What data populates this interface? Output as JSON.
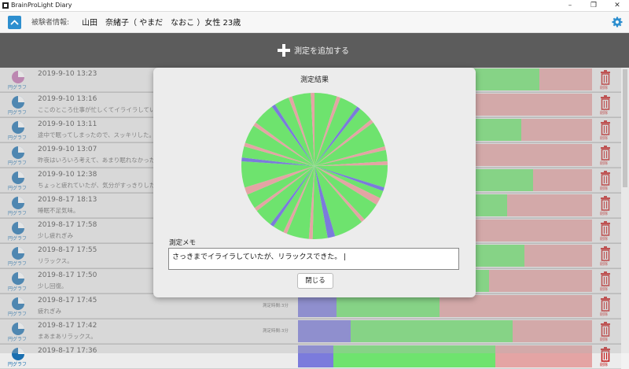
{
  "window": {
    "title": "BrainProLight Diary",
    "minimize": "–",
    "maximize": "❐",
    "close": "✕"
  },
  "subject": {
    "label": "被験者情報:",
    "value": "山田　奈緒子（ やまだ　なおこ ）女性 23歳"
  },
  "add_label": "測定を追加する",
  "colors": {
    "accent": "#2e8fcf",
    "purple": "#7b7bdc",
    "green": "#6ee36e",
    "pink": "#e4a4a4",
    "trash": "#c42020"
  },
  "row_icon_label": "円グラフ",
  "trash_label": "削除",
  "rows": [
    {
      "date": "2019-9-10 13:23",
      "memo": "",
      "duration": "",
      "bar": [
        0,
        0.82,
        0.18
      ],
      "active": true
    },
    {
      "date": "2019-9-10 13:16",
      "memo": "ここのところ仕事が忙しくてイライラしていた。",
      "duration": "",
      "bar": [
        0,
        0.3,
        0.7
      ]
    },
    {
      "date": "2019-9-10 13:11",
      "memo": "途中で眠ってしまったので、スッキリした。",
      "duration": "",
      "bar": [
        0,
        0.76,
        0.24
      ]
    },
    {
      "date": "2019-9-10 13:07",
      "memo": "昨夜はいろいろ考えて、あまり眠れなかった。",
      "duration": "",
      "bar": [
        0,
        0.25,
        0.75
      ]
    },
    {
      "date": "2019-9-10 12:38",
      "memo": "ちょっと疲れていたが、気分がすっきりした。",
      "duration": "",
      "bar": [
        0,
        0.8,
        0.2
      ]
    },
    {
      "date": "2019-8-17 18:13",
      "memo": "睡眠不足気味。",
      "duration": "",
      "bar": [
        0,
        0.71,
        0.29
      ]
    },
    {
      "date": "2019-8-17 17:58",
      "memo": "少し疲れぎみ",
      "duration": "",
      "bar": [
        0,
        0.55,
        0.45
      ]
    },
    {
      "date": "2019-8-17 17:55",
      "memo": "リラックス。",
      "duration": "",
      "bar": [
        0,
        0.77,
        0.23
      ]
    },
    {
      "date": "2019-8-17 17:50",
      "memo": "少し回復。",
      "duration": "",
      "bar": [
        0,
        0.65,
        0.35
      ]
    },
    {
      "date": "2019-8-17 17:45",
      "memo": "疲れぎみ",
      "duration": "測定時間:3分",
      "bar": [
        0.13,
        0.35,
        0.52
      ]
    },
    {
      "date": "2019-8-17 17:42",
      "memo": "まあまあリラックス。",
      "duration": "測定時間:3分",
      "bar": [
        0.18,
        0.55,
        0.27
      ]
    },
    {
      "date": "2019-8-17 17:36",
      "memo": "",
      "duration": "",
      "bar": [
        0.12,
        0.55,
        0.33
      ]
    }
  ],
  "dialog": {
    "title": "測定結果",
    "memo_label": "測定メモ",
    "memo_value": "さっきまでイライラしていたが、リラックスできた。",
    "close_label": "閉じる",
    "pie": {
      "slices": [
        {
          "c": "green",
          "w": 6
        },
        {
          "c": "pink",
          "w": 1
        },
        {
          "c": "green",
          "w": 5
        },
        {
          "c": "purple",
          "w": 1
        },
        {
          "c": "green",
          "w": 4
        },
        {
          "c": "pink",
          "w": 1
        },
        {
          "c": "green",
          "w": 7
        },
        {
          "c": "pink",
          "w": 1
        },
        {
          "c": "green",
          "w": 3
        },
        {
          "c": "pink",
          "w": 1
        },
        {
          "c": "green",
          "w": 6
        },
        {
          "c": "purple",
          "w": 1
        },
        {
          "c": "green",
          "w": 2
        },
        {
          "c": "pink",
          "w": 2
        },
        {
          "c": "green",
          "w": 5
        },
        {
          "c": "pink",
          "w": 1
        },
        {
          "c": "green",
          "w": 8
        },
        {
          "c": "purple",
          "w": 2
        },
        {
          "c": "green",
          "w": 4
        },
        {
          "c": "pink",
          "w": 1
        },
        {
          "c": "green",
          "w": 6
        },
        {
          "c": "pink",
          "w": 1
        },
        {
          "c": "green",
          "w": 3
        },
        {
          "c": "purple",
          "w": 1
        },
        {
          "c": "green",
          "w": 5
        },
        {
          "c": "pink",
          "w": 1
        },
        {
          "c": "green",
          "w": 4
        },
        {
          "c": "pink",
          "w": 2
        },
        {
          "c": "green",
          "w": 7
        },
        {
          "c": "purple",
          "w": 1
        },
        {
          "c": "green",
          "w": 3
        },
        {
          "c": "pink",
          "w": 1
        },
        {
          "c": "green",
          "w": 5
        },
        {
          "c": "pink",
          "w": 1
        },
        {
          "c": "green",
          "w": 6
        },
        {
          "c": "purple",
          "w": 1
        },
        {
          "c": "green",
          "w": 4
        },
        {
          "c": "pink",
          "w": 1
        },
        {
          "c": "green",
          "w": 5
        },
        {
          "c": "pink",
          "w": 1
        }
      ]
    }
  }
}
